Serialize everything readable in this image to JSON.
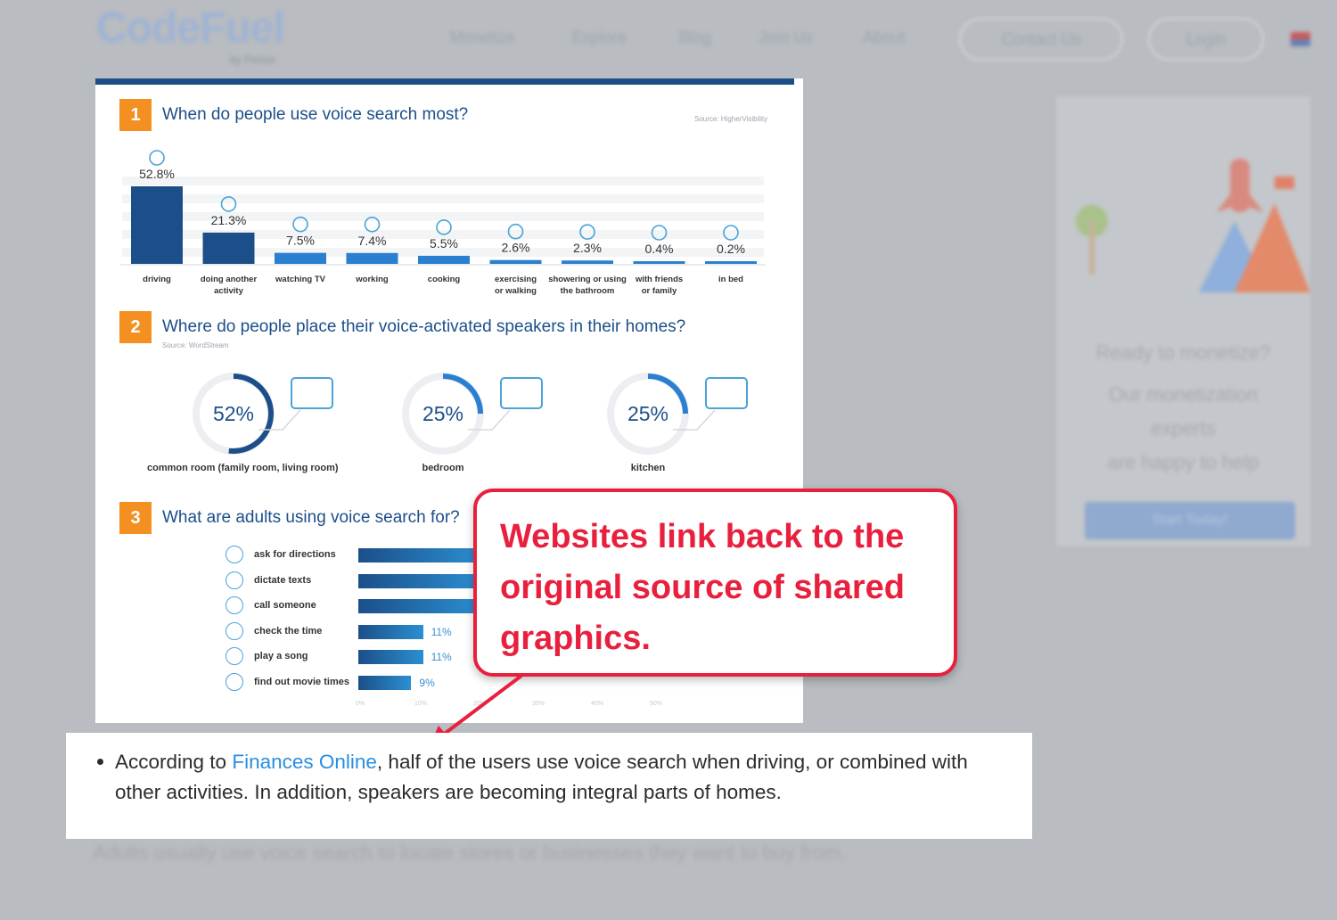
{
  "site": {
    "logo": "CodeFuel",
    "logo_sub": "by Perion",
    "nav": [
      "Monetize",
      "Explore",
      "Blog",
      "Join Us",
      "About"
    ],
    "contact_label": "Contact Us",
    "login_label": "Login"
  },
  "sidebar": {
    "heading": "Ready to monetize?",
    "line1": "Our monetization",
    "line2": "experts",
    "line3": "are happy to help",
    "button": "Start Today!"
  },
  "infographic": {
    "section1": {
      "num": "1",
      "title": "When do people use voice search most?",
      "source": "Source: HigherVisibility",
      "chart_data": {
        "type": "bar",
        "title": "When do people use voice search most?",
        "categories": [
          "driving",
          "doing another activity",
          "watching TV",
          "working",
          "cooking",
          "exercising or walking",
          "showering or using the bathroom",
          "with friends or family",
          "in bed"
        ],
        "values": [
          52.8,
          21.3,
          7.5,
          7.4,
          5.5,
          2.6,
          2.3,
          0.4,
          0.2
        ],
        "labels": [
          "52.8%",
          "21.3%",
          "7.5%",
          "7.4%",
          "5.5%",
          "2.6%",
          "2.3%",
          "0.4%",
          "0.2%"
        ],
        "label_lines": [
          [
            "driving"
          ],
          [
            "doing another",
            "activity"
          ],
          [
            "watching TV"
          ],
          [
            "working"
          ],
          [
            "cooking"
          ],
          [
            "exercising",
            "or walking"
          ],
          [
            "showering or using",
            "the bathroom"
          ],
          [
            "with friends",
            "or family"
          ],
          [
            "in bed"
          ]
        ],
        "unit": "%",
        "color": "#1c4f8a"
      }
    },
    "section2": {
      "num": "2",
      "title": "Where do people place their voice-activated speakers in their homes?",
      "source": "Source: WordStream",
      "chart_data": {
        "type": "pie",
        "categories": [
          "common room (family room, living room)",
          "bedroom",
          "kitchen"
        ],
        "values": [
          52,
          25,
          25
        ],
        "labels": [
          "52%",
          "25%",
          "25%"
        ],
        "color": "#1c4f8a",
        "accent": "#2b7fd1"
      }
    },
    "section3": {
      "num": "3",
      "title": "What are adults using voice search for?",
      "chart_data": {
        "type": "bar",
        "orientation": "horizontal",
        "categories": [
          "ask for directions",
          "dictate texts",
          "call someone",
          "check the time",
          "play a song",
          "find out movie times"
        ],
        "values": [
          null,
          null,
          null,
          11,
          11,
          9
        ],
        "labels": [
          "",
          "",
          "",
          "11%",
          "11%",
          "9%"
        ],
        "ticks": [
          "0%",
          "10%",
          "20%",
          "30%",
          "40%",
          "50%"
        ],
        "xlim": [
          0,
          50
        ],
        "icons": [
          "location-pin-icon",
          "text-message-icon",
          "phone-icon",
          "clock-icon",
          "music-note-icon",
          "movie-clapper-icon"
        ]
      }
    }
  },
  "callout": {
    "text": "Websites link back to the original source of shared graphics.",
    "color": "#e8203e"
  },
  "article": {
    "bullet_pre": "According to ",
    "bullet_link": "Finances Online",
    "bullet_post": ", half of the users use voice search when driving, or combined with other activities. In addition, speakers are becoming integral parts of homes.",
    "next_bullet": "Adults usually use voice search to locate stores or businesses they want to buy from."
  }
}
